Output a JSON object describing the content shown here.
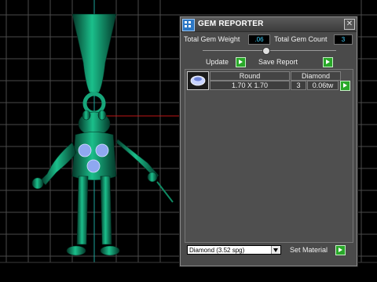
{
  "window": {
    "title": "GEM REPORTER",
    "close_glyph": "✕"
  },
  "totals": {
    "weight_label": "Total Gem Weight",
    "weight_value": ".06",
    "count_label": "Total Gem Count",
    "count_value": "3"
  },
  "actions": {
    "update_label": "Update",
    "save_report_label": "Save Report"
  },
  "gem_table": {
    "headers": [
      "Round",
      "Diamond"
    ],
    "rows": [
      {
        "size": "1.70 X 1.70",
        "count": "3",
        "weight": "0.06tw",
        "thumbnail_icon": "round-gem-icon"
      }
    ]
  },
  "material": {
    "selected": "Diamond   (3.52 spg)",
    "set_material_label": "Set Material"
  },
  "colors": {
    "model": "#0e8a63",
    "panel_bg": "#4a4a4a",
    "accent_green": "#29a829",
    "value_text": "#3fd3ff"
  }
}
